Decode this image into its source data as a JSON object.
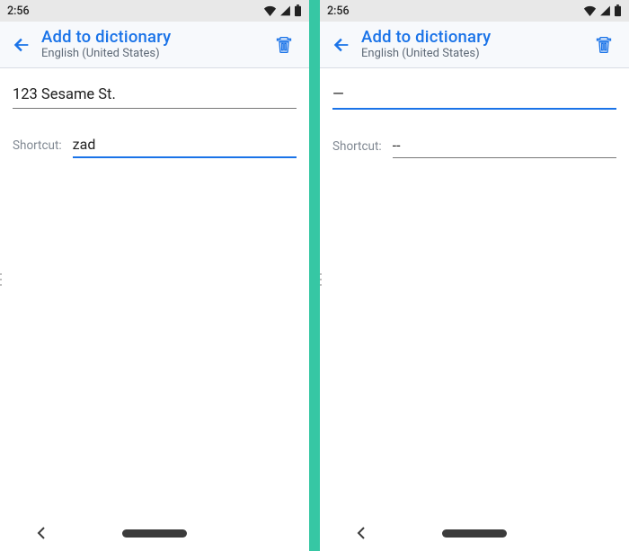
{
  "status": {
    "time": "2:56"
  },
  "appbar": {
    "title": "Add to dictionary",
    "subtitle": "English (United States)"
  },
  "labels": {
    "shortcut": "Shortcut:"
  },
  "left": {
    "word_value": "123 Sesame St.",
    "shortcut_value": "zad",
    "word_focused": false,
    "shortcut_focused": true
  },
  "right": {
    "word_value": "—",
    "shortcut_value": "--",
    "word_focused": true,
    "shortcut_focused": false
  },
  "colors": {
    "accent": "#1a73e8",
    "divider": "#36c7a4"
  }
}
